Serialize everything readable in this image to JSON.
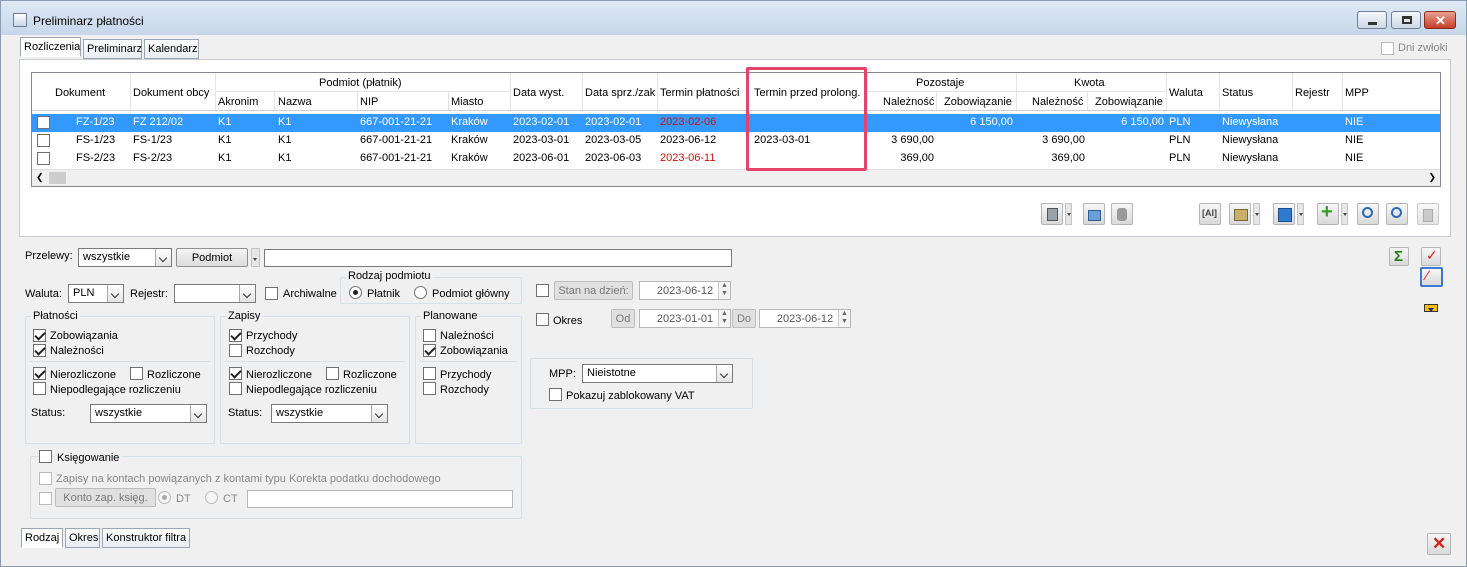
{
  "window": {
    "title": "Preliminarz płatności"
  },
  "top_tabs": [
    "Rozliczenia",
    "Preliminarz",
    "Kalendarz"
  ],
  "dni_zwloki": "Dni zwłoki",
  "grid": {
    "headers": {
      "dokument": "Dokument",
      "dokument_obcy": "Dokument obcy",
      "podmiot": "Podmiot (płatnik)",
      "akronim": "Akronim",
      "nazwa": "Nazwa",
      "nip": "NIP",
      "miasto": "Miasto",
      "data_wyst": "Data wyst.",
      "data_sprz": "Data sprz./zak",
      "termin": "Termin płatności",
      "termin_przed": "Termin przed prolong.",
      "pozostaje": "Pozostaje",
      "naleznosc": "Należność",
      "zobowiazanie": "Zobowiązanie",
      "kwota": "Kwota",
      "waluta": "Waluta",
      "status": "Status",
      "rejestr": "Rejestr",
      "mpp": "MPP"
    },
    "rows": [
      {
        "dok": "FZ-1/23",
        "obcy": "FZ 212/02",
        "akr": "K1",
        "nazwa": "K1",
        "nip": "667-001-21-21",
        "miasto": "Kraków",
        "wyst": "2023-02-01",
        "sprz": "2023-02-01",
        "termin": "2023-02-06",
        "przed": "",
        "poz_n": "",
        "poz_z": "6 150,00",
        "kw_n": "",
        "kw_z": "6 150,00",
        "wal": "PLN",
        "status": "Niewysłana",
        "rej": "",
        "mpp": "NIE"
      },
      {
        "dok": "FS-1/23",
        "obcy": "FS-1/23",
        "akr": "K1",
        "nazwa": "K1",
        "nip": "667-001-21-21",
        "miasto": "Kraków",
        "wyst": "2023-03-01",
        "sprz": "2023-03-05",
        "termin": "2023-06-12",
        "przed": "2023-03-01",
        "poz_n": "3 690,00",
        "poz_z": "",
        "kw_n": "3 690,00",
        "kw_z": "",
        "wal": "PLN",
        "status": "Niewysłana",
        "rej": "",
        "mpp": "NIE"
      },
      {
        "dok": "FS-2/23",
        "obcy": "FS-2/23",
        "akr": "K1",
        "nazwa": "K1",
        "nip": "667-001-21-21",
        "miasto": "Kraków",
        "wyst": "2023-06-01",
        "sprz": "2023-06-03",
        "termin": "2023-06-11",
        "przed": "",
        "poz_n": "369,00",
        "poz_z": "",
        "kw_n": "369,00",
        "kw_z": "",
        "wal": "PLN",
        "status": "Niewysłana",
        "rej": "",
        "mpp": "NIE"
      }
    ]
  },
  "filters": {
    "przelewy_label": "Przelewy:",
    "przelewy_value": "wszystkie",
    "podmiot_button": "Podmiot",
    "waluta_label": "Waluta:",
    "waluta_value": "PLN",
    "rejestr_label": "Rejestr:",
    "rejestr_value": "",
    "archiwalne": "Archiwalne",
    "rodzaj_podmiotu": "Rodzaj podmiotu",
    "platnik": "Płatnik",
    "podmiot_glowny": "Podmiot główny",
    "platnosci": "Płatności",
    "zobowiazania": "Zobowiązania",
    "naleznosci": "Należności",
    "nierozliczone": "Nierozliczone",
    "rozliczone": "Rozliczone",
    "niepodlegajace": "Niepodlegające rozliczeniu",
    "status_label": "Status:",
    "status_value": "wszystkie",
    "zapisy": "Zapisy",
    "przychody": "Przychody",
    "rozchody": "Rozchody",
    "planowane": "Planowane",
    "ksiegowanie": "Księgowanie",
    "zapisy_na_kontach": "Zapisy na kontach powiązanych z kontami typu Korekta podatku dochodowego",
    "konto_button": "Konto zap. księg.",
    "dt": "DT",
    "ct": "CT",
    "stan_na_dzien": "Stan na dzień:",
    "stan_date": "2023-06-12",
    "okres": "Okres",
    "od": "Od",
    "od_date": "2023-01-01",
    "do": "Do",
    "do_date": "2023-06-12",
    "mpp_label": "MPP:",
    "mpp_value": "Nieistotne",
    "pokazuj_vat": "Pokazuj zablokowany VAT"
  },
  "bottom_tabs": [
    "Rodzaj",
    "Okres",
    "Konstruktor filtra"
  ],
  "colors": {
    "selection": "#3399ff",
    "overdue": "#d01010",
    "highlight": "#e4446c"
  }
}
